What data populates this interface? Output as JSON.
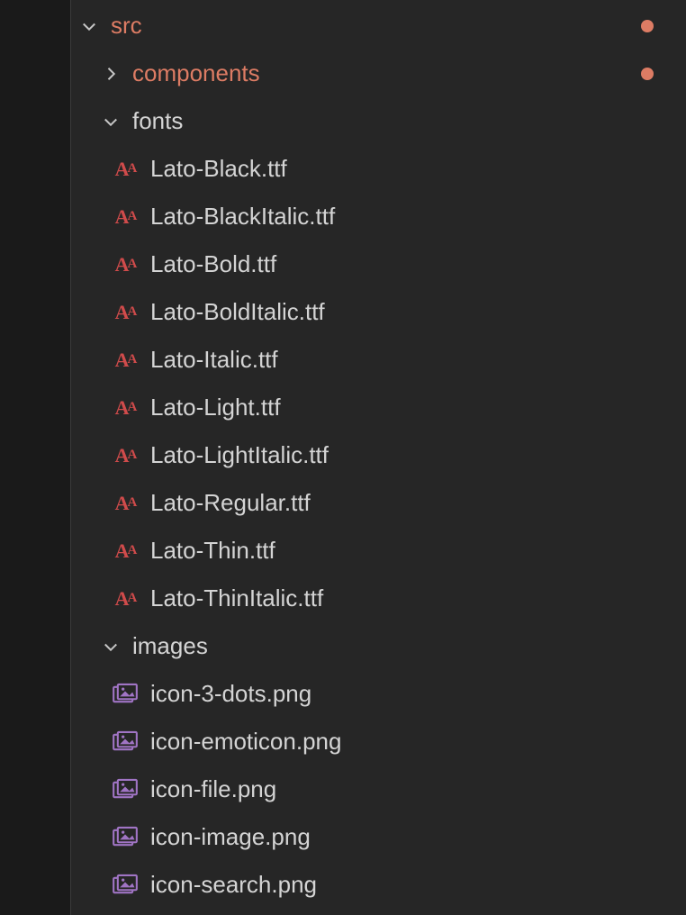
{
  "tree": [
    {
      "kind": "folder",
      "name": "src",
      "expanded": true,
      "modified": true,
      "dot": true,
      "indent": 0
    },
    {
      "kind": "folder",
      "name": "components",
      "expanded": false,
      "modified": true,
      "dot": true,
      "indent": 1
    },
    {
      "kind": "folder",
      "name": "fonts",
      "expanded": true,
      "modified": false,
      "dot": false,
      "indent": 1
    },
    {
      "kind": "file",
      "name": "Lato-Black.ttf",
      "icon": "font",
      "indent": 2
    },
    {
      "kind": "file",
      "name": "Lato-BlackItalic.ttf",
      "icon": "font",
      "indent": 2
    },
    {
      "kind": "file",
      "name": "Lato-Bold.ttf",
      "icon": "font",
      "indent": 2
    },
    {
      "kind": "file",
      "name": "Lato-BoldItalic.ttf",
      "icon": "font",
      "indent": 2
    },
    {
      "kind": "file",
      "name": "Lato-Italic.ttf",
      "icon": "font",
      "indent": 2
    },
    {
      "kind": "file",
      "name": "Lato-Light.ttf",
      "icon": "font",
      "indent": 2
    },
    {
      "kind": "file",
      "name": "Lato-LightItalic.ttf",
      "icon": "font",
      "indent": 2
    },
    {
      "kind": "file",
      "name": "Lato-Regular.ttf",
      "icon": "font",
      "indent": 2
    },
    {
      "kind": "file",
      "name": "Lato-Thin.ttf",
      "icon": "font",
      "indent": 2
    },
    {
      "kind": "file",
      "name": "Lato-ThinItalic.ttf",
      "icon": "font",
      "indent": 2
    },
    {
      "kind": "folder",
      "name": "images",
      "expanded": true,
      "modified": false,
      "dot": false,
      "indent": 1
    },
    {
      "kind": "file",
      "name": "icon-3-dots.png",
      "icon": "image",
      "indent": 2
    },
    {
      "kind": "file",
      "name": "icon-emoticon.png",
      "icon": "image",
      "indent": 2
    },
    {
      "kind": "file",
      "name": "icon-file.png",
      "icon": "image",
      "indent": 2
    },
    {
      "kind": "file",
      "name": "icon-image.png",
      "icon": "image",
      "indent": 2
    },
    {
      "kind": "file",
      "name": "icon-search.png",
      "icon": "image",
      "indent": 2
    }
  ],
  "colors": {
    "modified": "#dd7c64",
    "normal": "#d4d4d4",
    "fontIcon": "#d04b4b",
    "imageIcon": "#a074c4"
  }
}
